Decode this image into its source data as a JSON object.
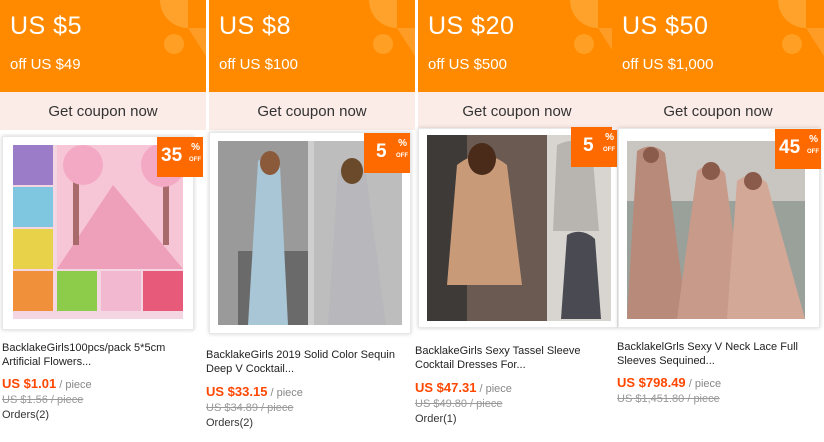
{
  "coupons": [
    {
      "amount": "US $5",
      "min_spend": "off US $49",
      "cta": "Get coupon now"
    },
    {
      "amount": "US $8",
      "min_spend": "off US $100",
      "cta": "Get coupon now"
    },
    {
      "amount": "US $20",
      "min_spend": "off US $500",
      "cta": "Get coupon now"
    },
    {
      "amount": "US $50",
      "min_spend": "off US $1,000",
      "cta": "Get coupon now"
    }
  ],
  "products": [
    {
      "discount": "35",
      "badge_symbol": "%",
      "badge_off": "OFF",
      "title": "BacklakeGirls100pcs/pack 5*5cm Artificial Flowers...",
      "price": "US $1.01",
      "per": " / piece",
      "original": "US $1.56 / piece",
      "orders": "Orders(2)"
    },
    {
      "discount": "5",
      "badge_symbol": "%",
      "badge_off": "OFF",
      "title": "BacklakeGirls 2019 Solid Color Sequin Deep V Cocktail...",
      "price": "US $33.15",
      "per": " / piece",
      "original": "US $34.89 / piece",
      "orders": "Orders(2)"
    },
    {
      "discount": "5",
      "badge_symbol": "%",
      "badge_off": "OFF",
      "title": "BacklakeGirls Sexy Tassel Sleeve Cocktail Dresses For...",
      "price": "US $47.31",
      "per": " / piece",
      "original": "US $49.80 / piece",
      "orders": "Order(1)"
    },
    {
      "discount": "45",
      "badge_symbol": "%",
      "badge_off": "OFF",
      "title": "BacklakelGrls Sexy V Neck Lace Full Sleeves Sequined...",
      "price": "US $798.49",
      "per": " / piece",
      "original": "US $1,451.80 / piece",
      "orders": ""
    }
  ],
  "colors": {
    "coupon": "#ff8a00",
    "badge": "#ff6a00",
    "price": "#ff4700"
  }
}
